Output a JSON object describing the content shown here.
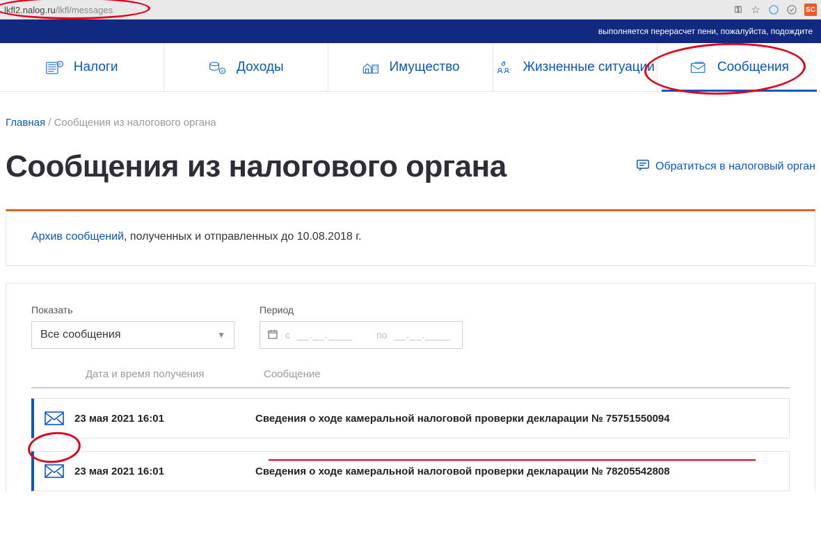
{
  "browser": {
    "url_host": "lkfl2.nalog.ru",
    "url_path": "/lkfl/messages",
    "badge": "SC"
  },
  "status_strip": "выполняется перерасчет пени, пожалуйста, подождите",
  "nav": {
    "items": [
      {
        "label": "Налоги"
      },
      {
        "label": "Доходы"
      },
      {
        "label": "Имущество"
      },
      {
        "label": "Жизненные ситуации"
      },
      {
        "label": "Сообщения"
      }
    ],
    "active_index": 4
  },
  "breadcrumb": {
    "home": "Главная",
    "current": "Сообщения из налогового органа"
  },
  "page": {
    "title": "Сообщения из налогового органа",
    "contact_label": "Обратиться в налоговый орган"
  },
  "archive": {
    "link_text": "Архив сообщений",
    "rest_text": ", полученных и отправленных до 10.08.2018 г."
  },
  "filters": {
    "show_label": "Показать",
    "show_value": "Все сообщения",
    "period_label": "Период",
    "period_from_prefix": "с",
    "period_placeholder": "__.__.____",
    "period_to_prefix": "по"
  },
  "table": {
    "col_date": "Дата и время получения",
    "col_msg": "Сообщение",
    "rows": [
      {
        "datetime": "23 мая 2021 16:01",
        "subject": "Сведения о ходе камеральной налоговой проверки декларации № 75751550094"
      },
      {
        "datetime": "23 мая 2021 16:01",
        "subject": "Сведения о ходе камеральной налоговой проверки декларации № 78205542808"
      }
    ]
  }
}
